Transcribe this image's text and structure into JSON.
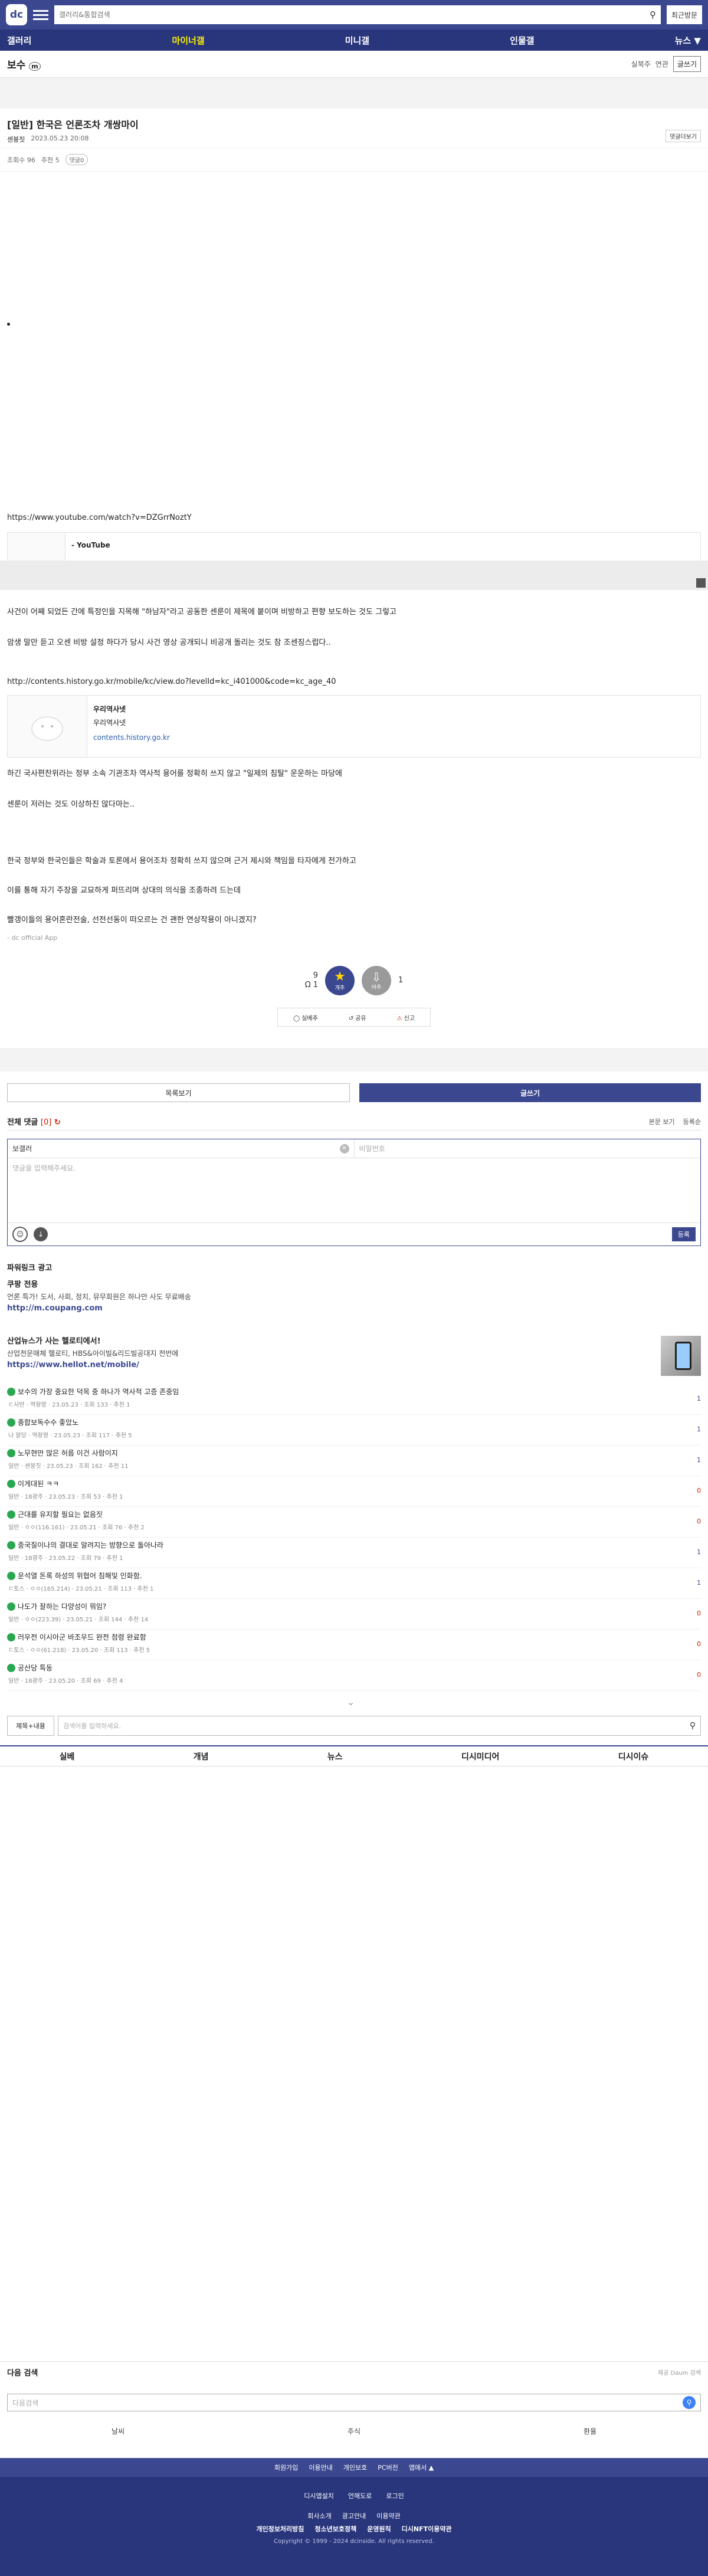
{
  "header": {
    "logo": "dc",
    "search_placeholder": "갤러리&통합검색",
    "recent_label": "최근방문"
  },
  "gnb": [
    "갤러리",
    "마이너갤",
    "미니갤",
    "인물갤",
    "뉴스 ▼"
  ],
  "gallery": {
    "title": "보수",
    "tag": "m",
    "realtime_label": "실북주",
    "connect_label": "연관",
    "write_label": "글쓰기"
  },
  "post": {
    "title": "[일반] 한국은 언론조차 개쌍마이",
    "author": "센붕짓",
    "date": "2023.05.23 20:08",
    "more": "댓글더보기",
    "views": "조회수 96",
    "recommend": "추천 5",
    "comments": "댓글0",
    "yt_url": "https://www.youtube.com/watch?v=DZGrrNoztY",
    "yt_title": "- YouTube",
    "line1": "사건이 어째 되었든 간에 특정인을 지목해 \"하남자\"라고 공동한 센룬이 제목에 붙이며 비방하고 편향 보도하는 것도 그렇고",
    "line2": "암생 말만 듣고 오센 비방 설정 하다가 당시 사건 영상 공개되니 비공개 돌리는 것도 참 조센징스럽다..",
    "link2": "http://contents.history.go.kr/mobile/kc/view.do?levelId=kc_i401000&code=kc_age_40",
    "card2_title": "우리역사넷",
    "card2_desc": "우리역사넷",
    "card2_url": "contents.history.go.kr",
    "line3": "하긴 국사편찬위라는 정부 소속 기관조차 역사적 용어를 정확히 쓰지 않고 \"일제의 침탈\" 운운하는 마당에",
    "line4": "센룬이 저러는 것도 이상하진 않다마는..",
    "line5": "한국 정부와 한국인들은 학술과 토론에서 용어조차 정확히 쓰지 않으며 근거 제시와 책임을 타자에게 전가하고",
    "line6": "이를 통해 자기 주장을 교묘하게 퍼뜨리며 상대의 의식을 조종하려 드는데",
    "line7": "빨갱이들의 용어혼란전술, 선전선동이 떠오르는 건 괜한 연상작용이 아니겠지?",
    "app_sign": "- dc official App",
    "up_count": "9",
    "up_fix": "Ω 1",
    "up_label": "개추",
    "down_label": "비추",
    "down_count": "1",
    "share1": "실베추",
    "share2": "공유",
    "share3": "신고"
  },
  "actions": {
    "list_label": "목록보기",
    "write_label": "글쓰기"
  },
  "comments": {
    "title": "전체 댓글",
    "count": "[0]",
    "sort1": "본문 보기",
    "sort2": "등록순",
    "nick_value": "보갤러",
    "pw_placeholder": "비밀번호",
    "text_placeholder": "댓글을 입력해주세요.",
    "submit_label": "등록"
  },
  "powerlink": {
    "title": "파워링크 광고",
    "ads": [
      {
        "t": "쿠팡 전용",
        "d": "언론 특가! 도서, 사회, 정치, 뮤무회원은 하나만 사도 무료배송",
        "u": "http://m.coupang.com"
      },
      {
        "t": "산업뉴스가 사는 헬로티에서!",
        "d": "산업전문매체 헬로티, HBS&아이빌&리드빌공대지 전번에",
        "u": "https://www.hellot.net/mobile/"
      }
    ]
  },
  "recs": [
    {
      "title": "보수의 가장 중요한 덕목 중 하나가 역사적 고증 존중임",
      "meta": "ㄷ사반 · 역황영 · 23.05.23 · 조회 133 · 추천 1",
      "num": "1",
      "red": false
    },
    {
      "title": "종합보독수수 좋았노",
      "meta": "나 말당 · 역황영 · 23.05.23 · 조회 117 · 추천 5",
      "num": "1",
      "red": false
    },
    {
      "title": "노무현만 많은 허름 이건 사람이지",
      "meta": "일반 · 센붕짓 · 23.05.23 · 조회 162 · 추천 11",
      "num": "1",
      "red": false
    },
    {
      "title": "이게대된 ㅋㅋ",
      "meta": "일반 · 18광주 · 23.05.23 · 조회 53 · 추천 1",
      "num": "0",
      "red": true
    },
    {
      "title": "근대를 유지할 필요는 없음짓",
      "meta": "일반 · ㅇㅇ(116.161) · 23.05.21 · 조회 76 · 추천 2",
      "num": "0",
      "red": true
    },
    {
      "title": "중국질이나의 결대로 알려지는 방향으로 돌아나라",
      "meta": "일반 · 18광주 · 23.05.22 · 조회 79 · 추천 1",
      "num": "1",
      "red": false
    },
    {
      "title": "운석열 돈록 하성의 위협어 침해및 인화함.",
      "meta": "ㄷ토스 · ㅇㅇ(165.214) · 23.05.21 · 조회 113 · 추천 1",
      "num": "1",
      "red": false
    },
    {
      "title": "나도가 잘하는 다양성이 뭐임?",
      "meta": "일반 · ㅇㅇ(223.39) · 23.05.21 · 조회 144 · 추천 14",
      "num": "0",
      "red": true
    },
    {
      "title": "러우전 이시아군 바조우드 완전 점령 완료함",
      "meta": "ㄷ토스 · ㅇㅇ(61.218) · 23.05.20 · 조회 113 · 추천 5",
      "num": "0",
      "red": true
    },
    {
      "title": "공산당 특동",
      "meta": "일반 · 18광주 · 23.05.20 · 조회 69 · 추천 4",
      "num": "0",
      "red": true
    }
  ],
  "search": {
    "select_label": "제목+내용",
    "placeholder": "검색어를 입력하세요."
  },
  "gnb2": [
    "실베",
    "개념",
    "뉴스",
    "디시미디어",
    "디시이슈"
  ],
  "daum": {
    "title": "다음 검색",
    "by": "제공 Daum 검색",
    "placeholder": "다음검색",
    "tabs": [
      "날씨",
      "주식",
      "환율"
    ]
  },
  "footer": {
    "r1": [
      "회원가입",
      "이용안내",
      "개인보호",
      "PC버전",
      "앱에서 ▲"
    ],
    "r2": [
      "디시앱설치",
      "언해도로",
      "로그인"
    ],
    "r3": [
      "회사소개",
      "광고안내",
      "이용약관"
    ],
    "r4": [
      "개인정보처리방침",
      "청소년보호정책",
      "운영원칙",
      "디시NFT이용약관"
    ],
    "copyright": "Copyright © 1999 - 2024 dcinside. All rights reserved."
  }
}
